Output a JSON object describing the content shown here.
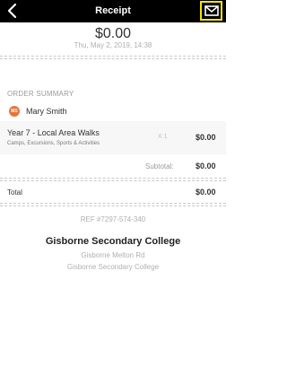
{
  "header": {
    "title": "Receipt",
    "back_icon": "chevron-left-icon",
    "mail_icon": "envelope-icon",
    "highlight_color": "#f2e600"
  },
  "receipt": {
    "amount": "$0.00",
    "datetime": "Thu, May 2, 2019, 14:38"
  },
  "order_summary": {
    "title": "ORDER SUMMARY",
    "customer": {
      "initials": "MS",
      "name": "Mary Smith",
      "avatar_color": "#e8743b"
    },
    "items": [
      {
        "name": "Year 7 - Local Area Walks",
        "category": "Camps, Excursions, Sports & Activities",
        "quantity": "X 1",
        "price": "$0.00"
      }
    ],
    "subtotal_label": "Subtotal:",
    "subtotal_value": "$0.00",
    "total_label": "Total",
    "total_value": "$0.00"
  },
  "reference": "REF #7297-574-340",
  "organisation": {
    "name": "Gisborne Secondary College",
    "address_line1": "Gisborne Melton Rd",
    "address_line2": "Gisborne Secondary College"
  }
}
